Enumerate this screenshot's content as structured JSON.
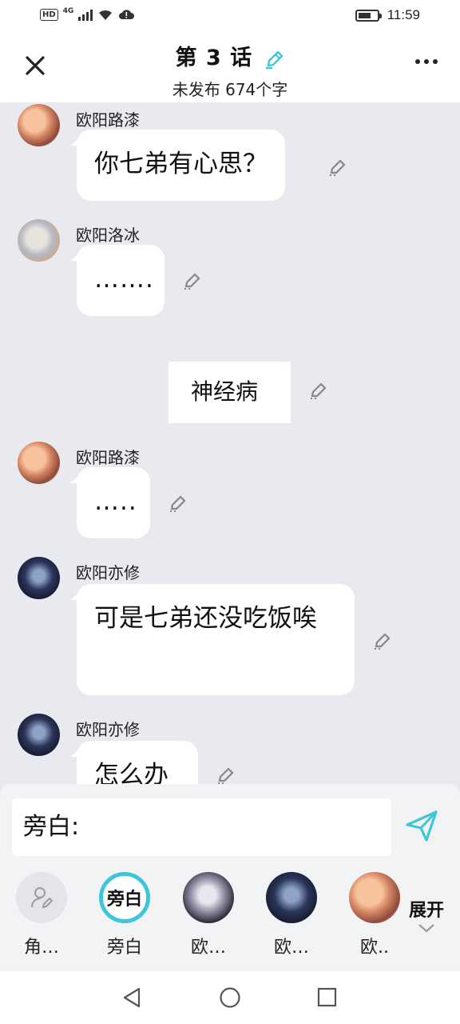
{
  "status_bar": {
    "network": "4G",
    "hd": "HD",
    "time": "11:59"
  },
  "header": {
    "title": "第 3 话",
    "subtitle": "未发布 674个字"
  },
  "messages": [
    {
      "type": "character",
      "name": "欧阳路漆",
      "text": "你七弟有心思？"
    },
    {
      "type": "character",
      "name": "欧阳洛冰",
      "text": "……."
    },
    {
      "type": "narration",
      "text": "神经病"
    },
    {
      "type": "character",
      "name": "欧阳路漆",
      "text": "….."
    },
    {
      "type": "character",
      "name": "欧阳亦修",
      "text": "可是七弟还没吃饭唉"
    },
    {
      "type": "character",
      "name": "欧阳亦修",
      "text": "怎么办"
    }
  ],
  "composer": {
    "input_value": "旁白:",
    "roles": [
      {
        "label": "角…"
      },
      {
        "label": "旁白",
        "badge": "旁白"
      },
      {
        "label": "欧…"
      },
      {
        "label": "欧…"
      },
      {
        "label": "欧.."
      }
    ],
    "expand_label": "展开"
  },
  "colors": {
    "accent": "#3ec6d8",
    "background": "#e9eaef",
    "bubble": "#ffffff"
  },
  "icons": [
    "close-icon",
    "pen-icon",
    "more-icon",
    "edit-icon",
    "send-icon",
    "add-character-icon",
    "chevron-down-icon",
    "back-icon",
    "home-icon",
    "recents-icon"
  ]
}
